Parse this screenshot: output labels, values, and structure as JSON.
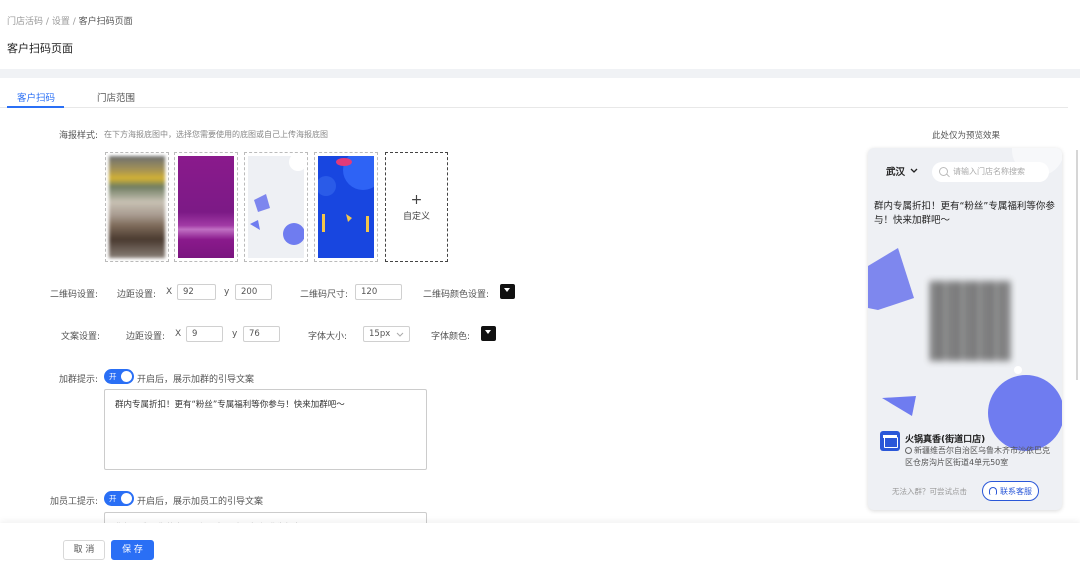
{
  "breadcrumb": {
    "item1": "门店活码",
    "sep": "/",
    "item2": "设置",
    "current": "客户扫码页面"
  },
  "page_title": "客户扫码页面",
  "tabs": [
    {
      "label": "客户扫码"
    },
    {
      "label": "门店范围"
    }
  ],
  "poster": {
    "label": "海报样式:",
    "hint": "在下方海报底图中，选择您需要使用的底图或自己上传海报底图",
    "add_plus": "+",
    "add_label": "自定义"
  },
  "qrcode_settings": {
    "label": "二维码设置:",
    "margin_label": "边距设置:",
    "x_label": "X",
    "x_value": "92",
    "y_label": "y",
    "y_value": "200",
    "size_label": "二维码尺寸:",
    "size_value": "120",
    "color_label": "二维码颜色设置:",
    "color": "#111111"
  },
  "text_settings": {
    "label": "文案设置:",
    "margin_label": "边距设置:",
    "x_label": "X",
    "x_value": "9",
    "y_label": "y",
    "y_value": "76",
    "font_size_label": "字体大小:",
    "font_size_value": "15px",
    "font_color_label": "字体颜色:",
    "color": "#111111"
  },
  "join_group": {
    "label": "加群提示:",
    "toggle_text": "开",
    "desc": "开启后，展示加群的引导文案",
    "text": "群内专属折扣！更有“粉丝”专属福利等你参与！快来加群吧～"
  },
  "add_staff": {
    "label": "加员工提示:",
    "toggle_text": "开",
    "desc": "开启后，展示加员工的引导文案",
    "text": "你好，我是你的专属顾问，扫码立即添加我为好友～"
  },
  "footer": {
    "cancel": "取 消",
    "save": "保 存"
  },
  "preview": {
    "note": "此处仅为预览效果",
    "city": "武汉",
    "search_placeholder": "请输入门店名称搜索",
    "group_text": "群内专属折扣！更有“粉丝”专属福利等你参与！快来加群吧～",
    "store_name": "火锅真香(街道口店)",
    "address": "新疆维吾尔自治区乌鲁木齐市沙依巴克区仓房沟片区街道4单元50室",
    "no_group": "无法入群？可尝试点击",
    "contact_button": "联系客服"
  },
  "colors": {
    "accent": "#2a6ff5",
    "preview_bg": "#eef0f4",
    "shape_blue": "#6f7cf0"
  }
}
